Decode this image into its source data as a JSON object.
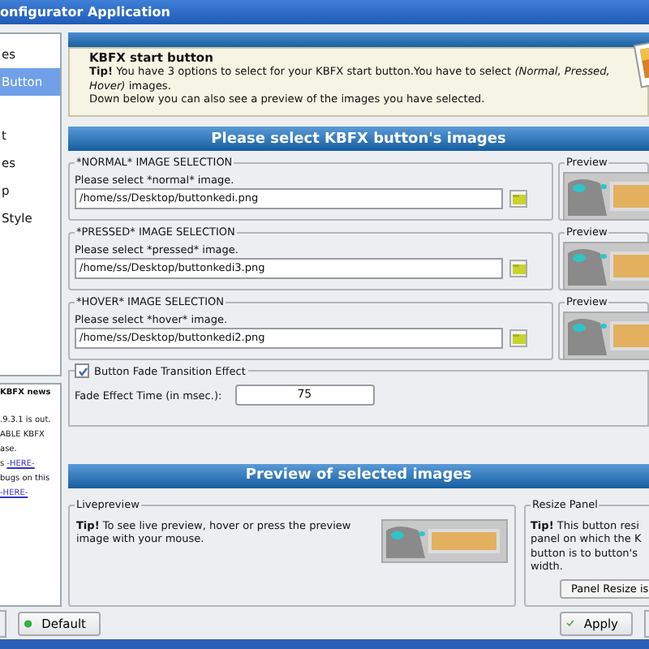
{
  "window": {
    "title": "onfigurator Application"
  },
  "sidebar": {
    "items": [
      {
        "label": "es",
        "selected": false
      },
      {
        "label": "Button",
        "selected": true
      },
      {
        "label": "t",
        "selected": false
      },
      {
        "label": "es",
        "selected": false
      },
      {
        "label": "p",
        "selected": false
      },
      {
        "label": "Style",
        "selected": false
      }
    ]
  },
  "news": {
    "title": "KBFX news",
    "lines": [
      {
        "text": ".9.3.1 is out."
      },
      {
        "text": "ABLE KBFX"
      },
      {
        "text": "ase."
      },
      {
        "text": "s",
        "link": "-HERE-"
      },
      {
        "text": "bugs on this"
      },
      {
        "link": "-HERE-"
      }
    ]
  },
  "header": {
    "title": "KBFX start button",
    "lines": [
      "**Tip!** You have 3 options to select for your KBFX start button.You have to select *(Normal, Pressed,*",
      "*Hover)* images.",
      "Down below you can also see a preview of the images you have selected."
    ]
  },
  "selection_title": "Please select KBFX button's images",
  "selections": [
    {
      "title": "*NORMAL* IMAGE SELECTION",
      "prompt": "Please select *normal* image.",
      "path": "/home/ss/Desktop/buttonkedi.png",
      "preview_label": "Preview"
    },
    {
      "title": "*PRESSED* IMAGE SELECTION",
      "prompt": "Please select *pressed* image.",
      "path": "/home/ss/Desktop/buttonkedi3.png",
      "preview_label": "Preview"
    },
    {
      "title": "*HOVER* IMAGE SELECTION",
      "prompt": "Please select *hover* image.",
      "path": "/home/ss/Desktop/buttonkedi2.png",
      "preview_label": "Preview"
    }
  ],
  "fade": {
    "label": "Button Fade Transition Effect",
    "checked": true,
    "time_label": "Fade Effect Time (in msec.):",
    "time_value": "75"
  },
  "preview_title": "Preview of selected images",
  "live": {
    "title": "Livepreview",
    "tip": "**Tip!** To see live preview, hover or press the preview image with your mouse."
  },
  "resize": {
    "title": "Resize Panel",
    "lines": [
      "**Tip!** This button resi",
      "panel on which the K",
      "button is to button's",
      "width."
    ],
    "button": "Panel Resize is"
  },
  "buttons": {
    "default": "Default",
    "apply": "Apply"
  }
}
